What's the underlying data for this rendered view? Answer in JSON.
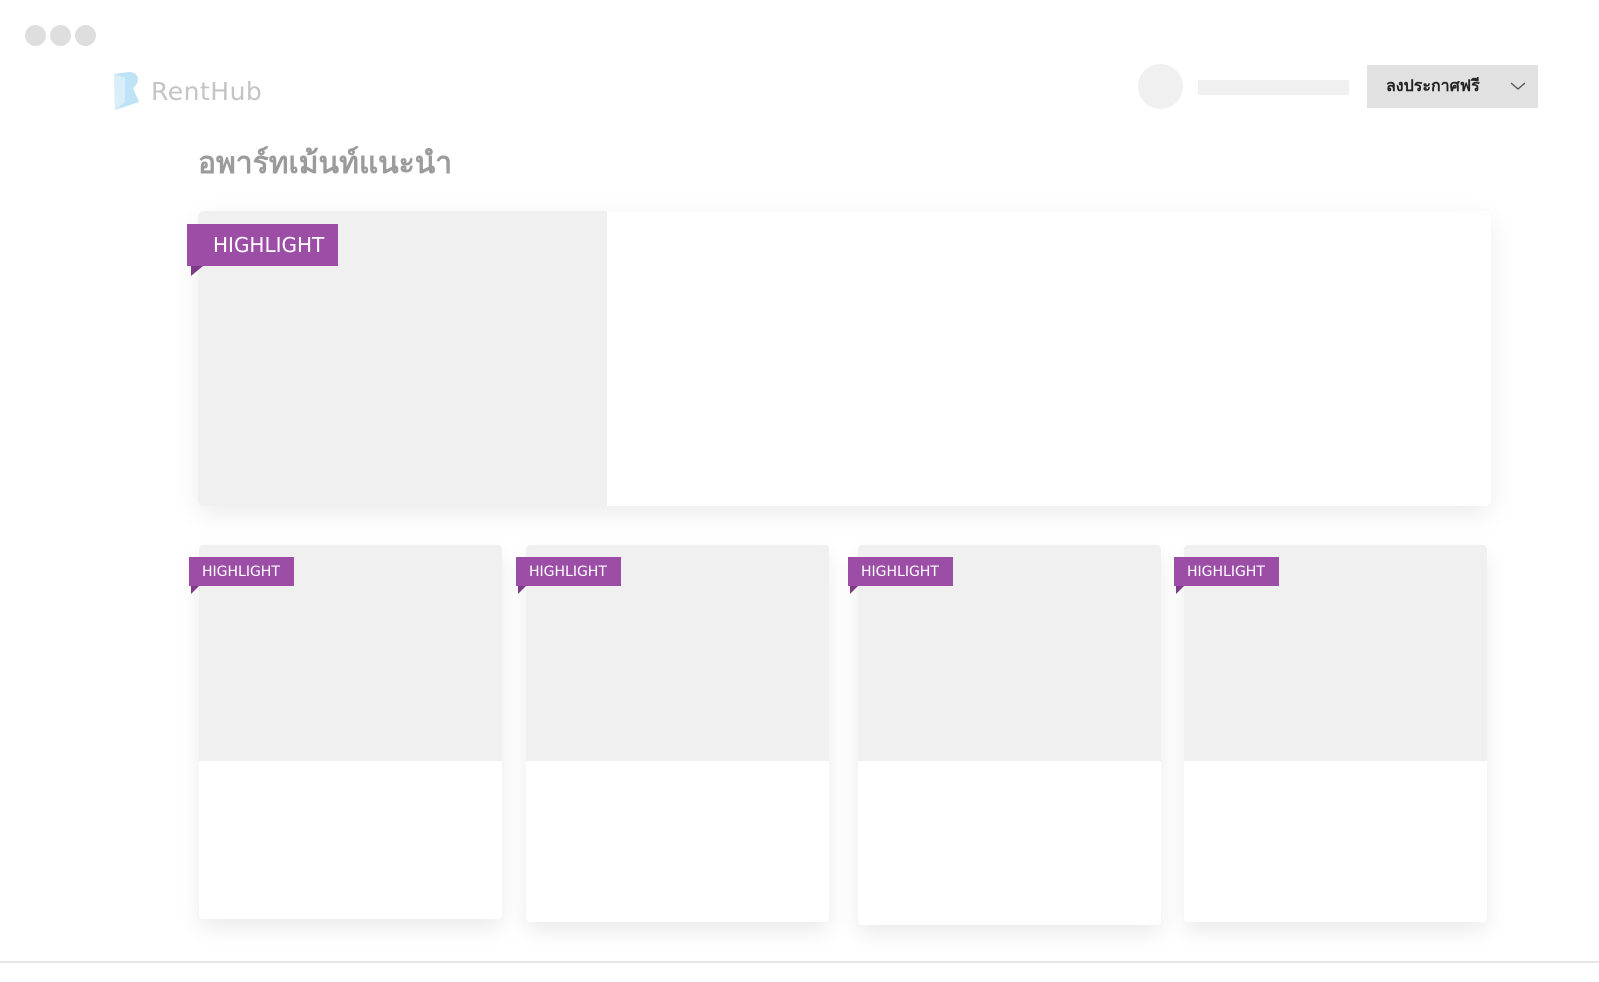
{
  "header": {
    "logo_text": "RentHub",
    "post_button_label": "ลงประกาศฟรี"
  },
  "section": {
    "title": "อพาร์ทเม้นท์แนะนำ"
  },
  "featured": {
    "badge": "HIGHLIGHT"
  },
  "cards": [
    {
      "badge": "HIGHLIGHT"
    },
    {
      "badge": "HIGHLIGHT"
    },
    {
      "badge": "HIGHLIGHT"
    },
    {
      "badge": "HIGHLIGHT"
    }
  ],
  "colors": {
    "highlight_badge": "#9c4ea6",
    "placeholder": "#f0f0f0",
    "logo_accent": "#bfe3f6"
  }
}
